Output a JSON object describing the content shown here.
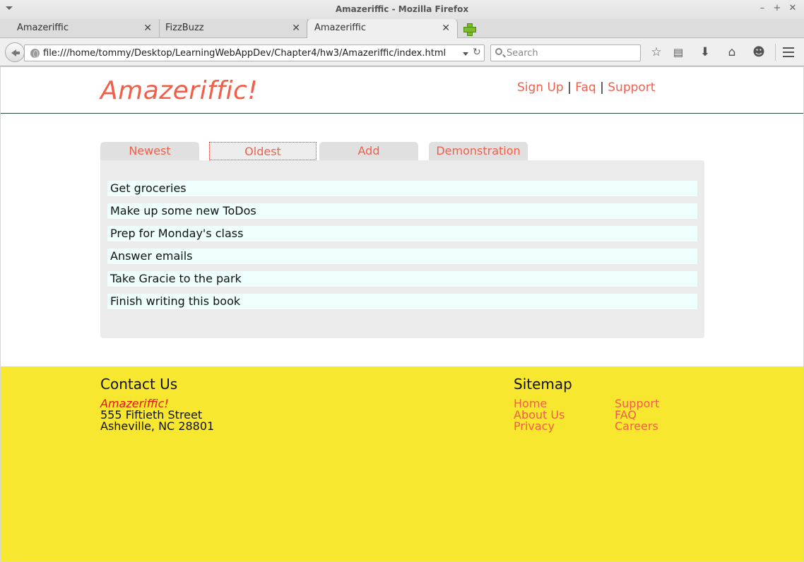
{
  "window": {
    "title": "Amazeriffic - Mozilla Firefox"
  },
  "browser_tabs": [
    {
      "label": "Amazeriffic"
    },
    {
      "label": "FizzBuzz"
    },
    {
      "label": "Amazeriffic"
    }
  ],
  "address_bar": {
    "url": "file:///home/tommy/Desktop/LearningWebAppDev/Chapter4/hw3/Amazeriffic/index.html"
  },
  "search_bar": {
    "placeholder": "Search"
  },
  "site": {
    "logo": "Amazeriffic!",
    "nav": {
      "signup": "Sign Up",
      "faq": "Faq",
      "support": "Support",
      "separator": "|"
    }
  },
  "tabs": [
    {
      "label": "Newest"
    },
    {
      "label": "Oldest",
      "active": true
    },
    {
      "label": "Add"
    },
    {
      "label": "Demonstration"
    }
  ],
  "todos": [
    "Get groceries",
    "Make up some new ToDos",
    "Prep for Monday's class",
    "Answer emails",
    "Take Gracie to the park",
    "Finish writing this book"
  ],
  "footer": {
    "contact": {
      "heading": "Contact Us",
      "brand": "Amazeriffic!",
      "street": "555 Fiftieth Street",
      "city": "Asheville, NC 28801"
    },
    "sitemap": {
      "heading": "Sitemap",
      "links": [
        "Home",
        "About Us",
        "Privacy",
        "Support",
        "FAQ",
        "Careers"
      ]
    }
  },
  "colors": {
    "accent": "#f15f4a",
    "footer_bg": "#f8e72f",
    "brand_red": "#e8140c",
    "todo_bg": "#eefffe"
  }
}
